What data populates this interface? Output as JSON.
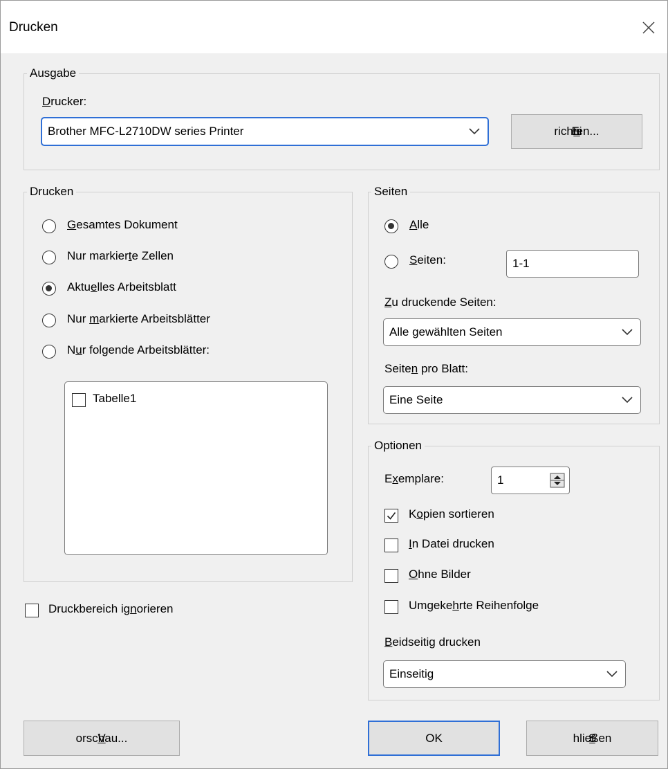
{
  "window": {
    "title": "Drucken"
  },
  "ausgabe": {
    "legend": "Ausgabe",
    "printer_label_u": "D",
    "printer_label_rest": "rucker:",
    "printer_value": "Brother MFC-L2710DW series Printer",
    "setup_pre": "Ei",
    "setup_u": "n",
    "setup_post": "richten..."
  },
  "drucken": {
    "legend": "Drucken",
    "options": [
      {
        "pre": "",
        "u": "G",
        "post": "esamtes Dokument",
        "selected": false
      },
      {
        "pre": "Nur markier",
        "u": "t",
        "post": "e Zellen",
        "selected": false
      },
      {
        "pre": "Aktu",
        "u": "e",
        "post": "lles Arbeitsblatt",
        "selected": true
      },
      {
        "pre": "Nur ",
        "u": "m",
        "post": "arkierte Arbeitsblätter",
        "selected": false
      },
      {
        "pre": "N",
        "u": "u",
        "post": "r folgende Arbeitsblätter:",
        "selected": false
      }
    ],
    "sheets": [
      {
        "label": "Tabelle1",
        "checked": false
      }
    ]
  },
  "ignore_print_area": {
    "pre": "Druckbereich ig",
    "u": "n",
    "post": "orieren",
    "checked": false
  },
  "seiten": {
    "legend": "Seiten",
    "all_u": "A",
    "all_rest": "lle",
    "pages_u": "S",
    "pages_rest": "eiten:",
    "pages_value": "1-1",
    "print_pages_u": "Z",
    "print_pages_rest": "u druckende Seiten:",
    "print_pages_value": "Alle gewählten Seiten",
    "per_sheet_pre": "Seite",
    "per_sheet_u": "n",
    "per_sheet_post": " pro Blatt:",
    "per_sheet_value": "Eine Seite"
  },
  "optionen": {
    "legend": "Optionen",
    "copies_pre": "E",
    "copies_u": "x",
    "copies_post": "emplare:",
    "copies_value": "1",
    "checks": [
      {
        "pre": "K",
        "u": "o",
        "post": "pien sortieren",
        "checked": true
      },
      {
        "pre": "",
        "u": "I",
        "post": "n Datei drucken",
        "checked": false
      },
      {
        "pre": "",
        "u": "O",
        "post": "hne Bilder",
        "checked": false
      },
      {
        "pre": "Umgeke",
        "u": "h",
        "post": "rte Reihenfolge",
        "checked": false
      }
    ],
    "duplex_u": "B",
    "duplex_rest": "eidseitig drucken",
    "duplex_value": "Einseitig"
  },
  "buttons": {
    "preview_u": "V",
    "preview_rest": "orschau...",
    "ok": "OK",
    "close_pre": "S",
    "close_u": "c",
    "close_post": "hließen"
  }
}
